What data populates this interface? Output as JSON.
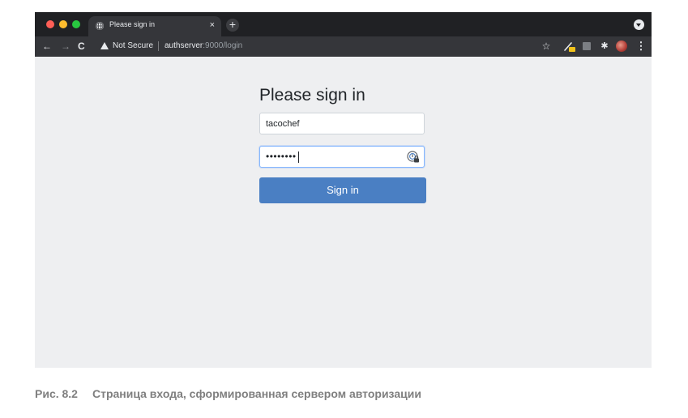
{
  "browser": {
    "tab": {
      "title": "Please sign in",
      "close_glyph": "×",
      "icon": "globe-icon"
    },
    "new_tab_glyph": "+",
    "nav": {
      "back_glyph": "←",
      "forward_glyph": "→",
      "reload_glyph": "C"
    },
    "address": {
      "security_label": "Not Secure",
      "host": "authserver",
      "rest": ":9000/login"
    },
    "toolbar_icons": {
      "bookmark_glyph": "☆",
      "extensions_glyph": "✱",
      "menu_glyph": "⋮"
    }
  },
  "login": {
    "heading": "Please sign in",
    "username_value": "tacochef",
    "password_masked": "••••••••",
    "submit_label": "Sign in"
  },
  "caption": {
    "number": "Рис. 8.2",
    "text": "Страница входа, сформированная сервером авторизации"
  },
  "colors": {
    "chrome_dark": "#202124",
    "toolbar": "#35363a",
    "page_bg": "#eeeff1",
    "button_primary": "#4a7fc3",
    "caption_gray": "#7f7f7f"
  }
}
